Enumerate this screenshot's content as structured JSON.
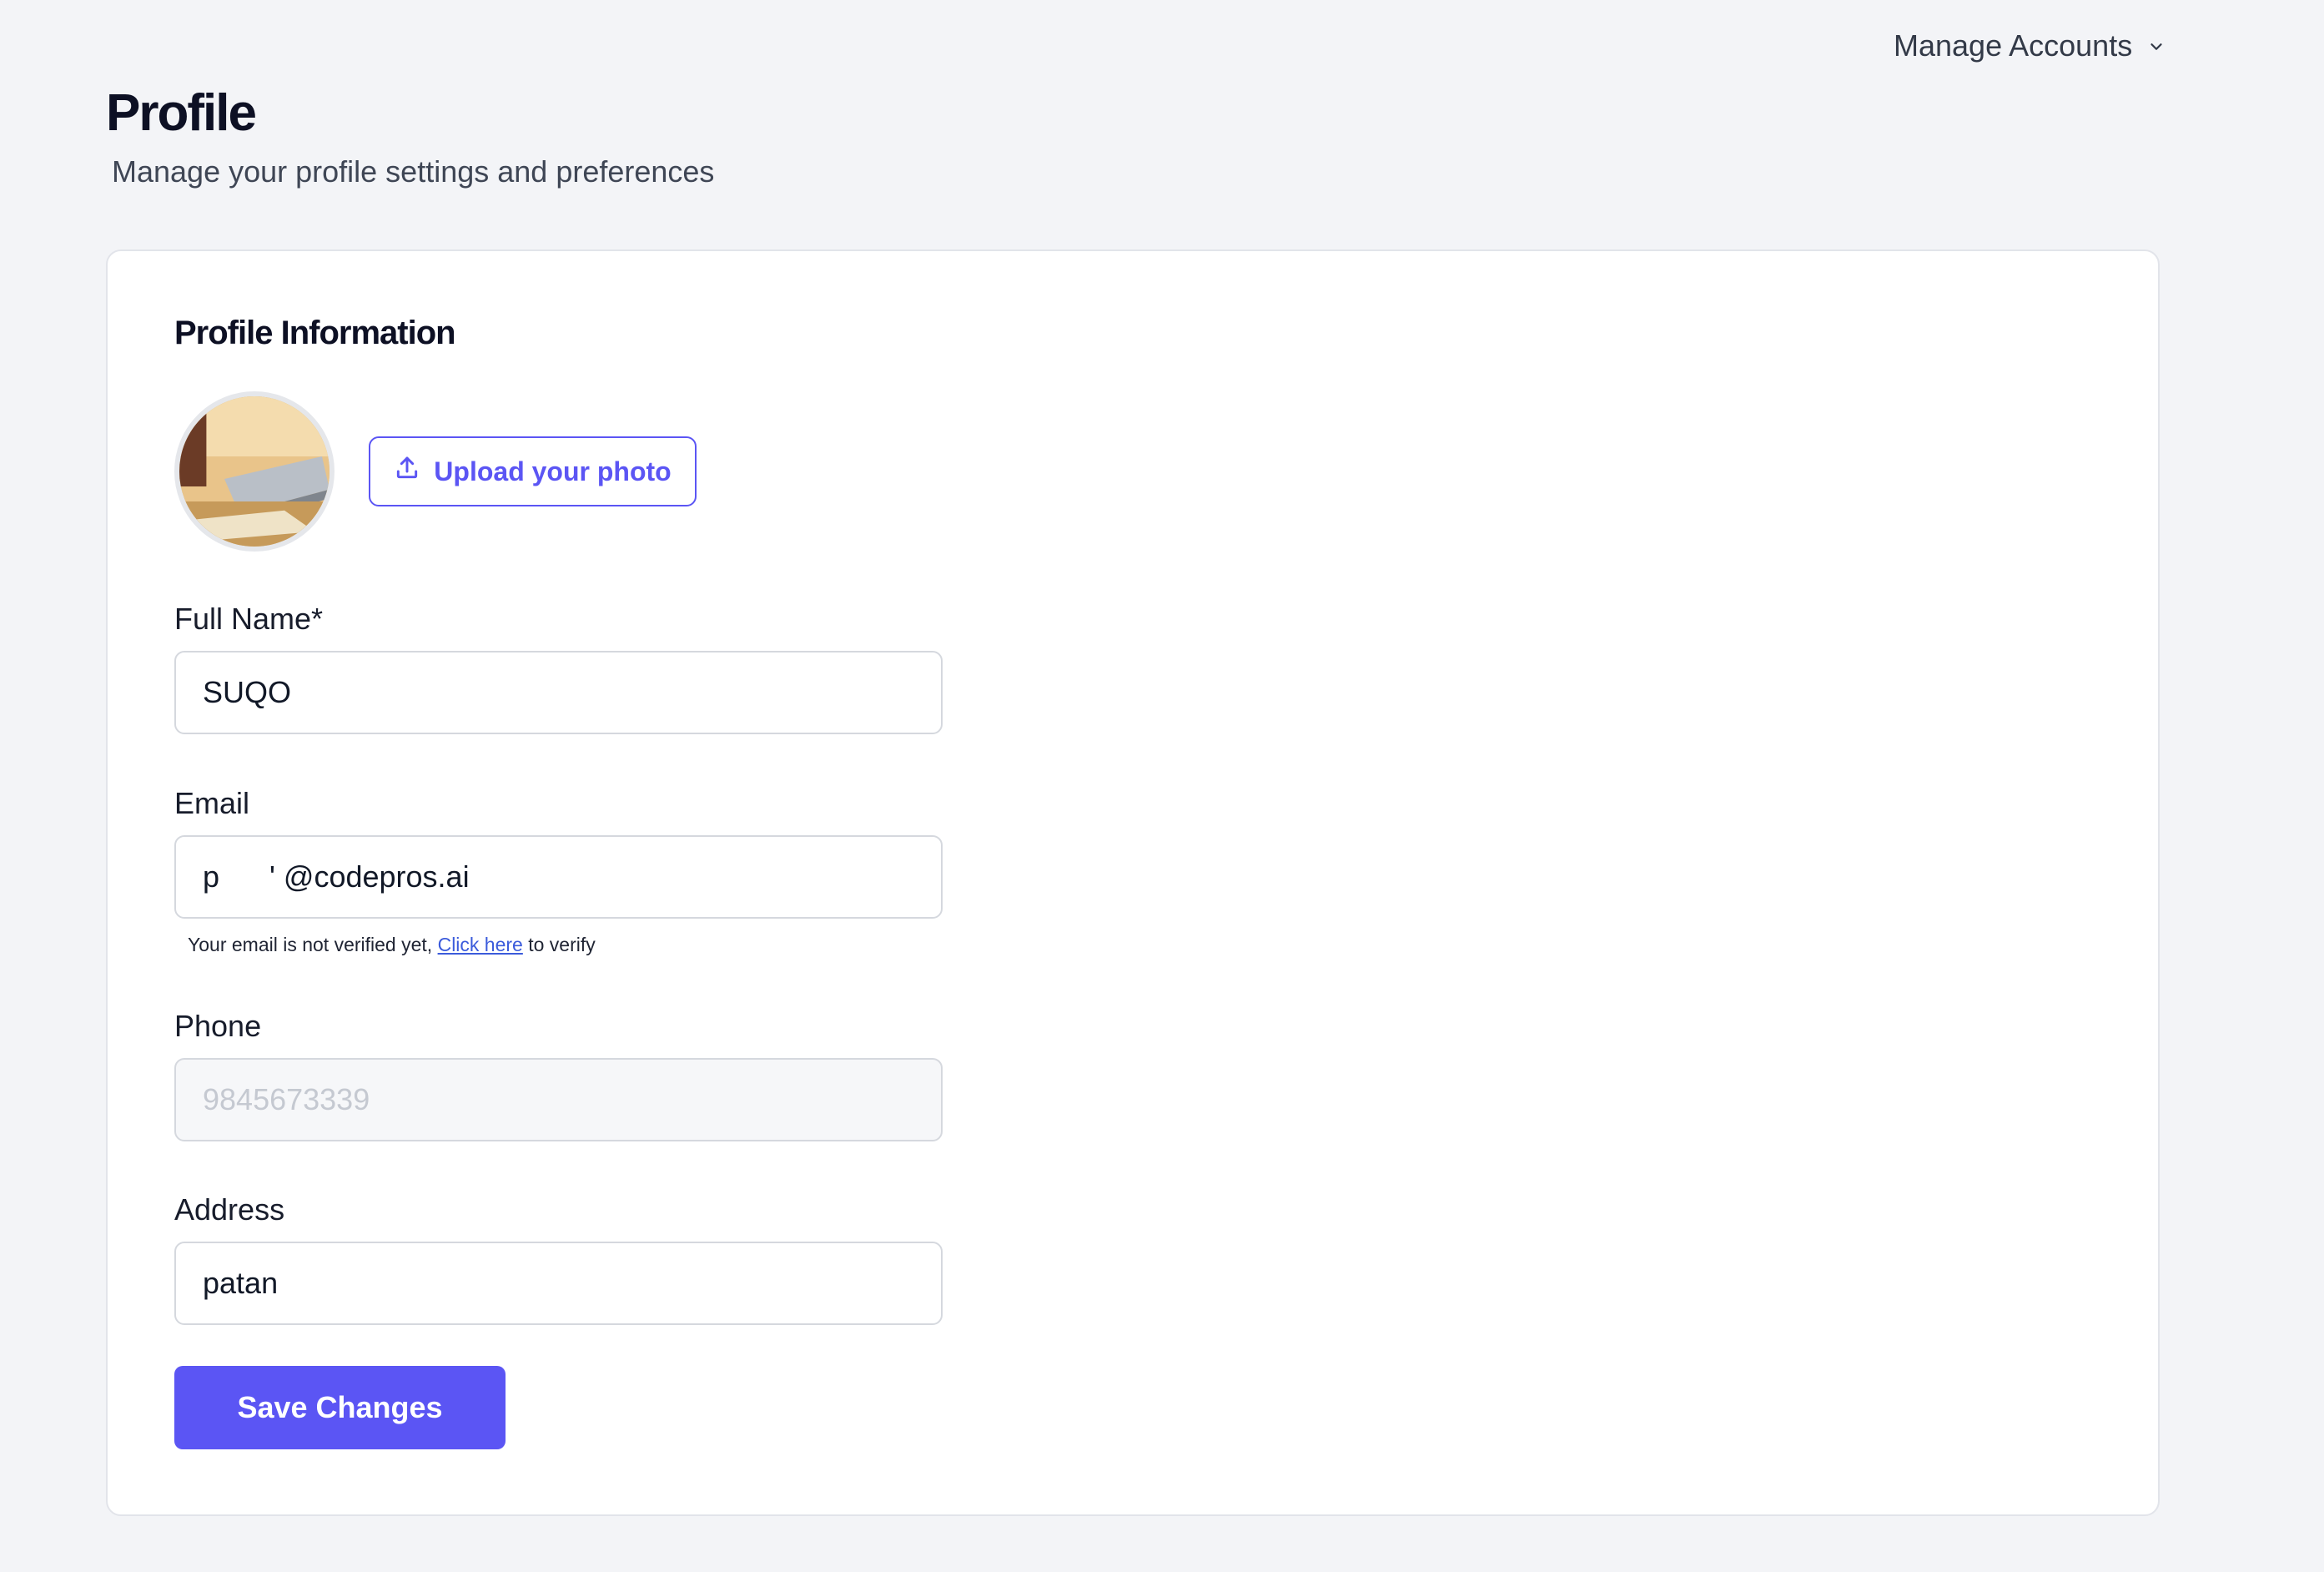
{
  "header": {
    "manage_accounts_label": "Manage Accounts",
    "title": "Profile",
    "subtitle": "Manage your profile settings and preferences"
  },
  "profile_card": {
    "section_title": "Profile Information",
    "upload_label": "Upload your photo",
    "fields": {
      "full_name": {
        "label": "Full Name*",
        "value": "SUQO"
      },
      "email": {
        "label": "Email",
        "value": "p      ' @codepros.ai"
      },
      "phone": {
        "label": "Phone",
        "value": "9845673339"
      },
      "address": {
        "label": "Address",
        "value": "patan"
      }
    },
    "verify_note": {
      "prefix": "Your email is not verified yet,",
      "link": "Click here",
      "suffix": "to verify"
    },
    "save_label": "Save Changes"
  },
  "colors": {
    "accent": "#5b55f4",
    "background": "#f3f4f7",
    "card": "#ffffff",
    "link": "#3b5bdb"
  },
  "icons": {
    "upload": "upload-icon",
    "chevron": "chevron-down-icon"
  }
}
